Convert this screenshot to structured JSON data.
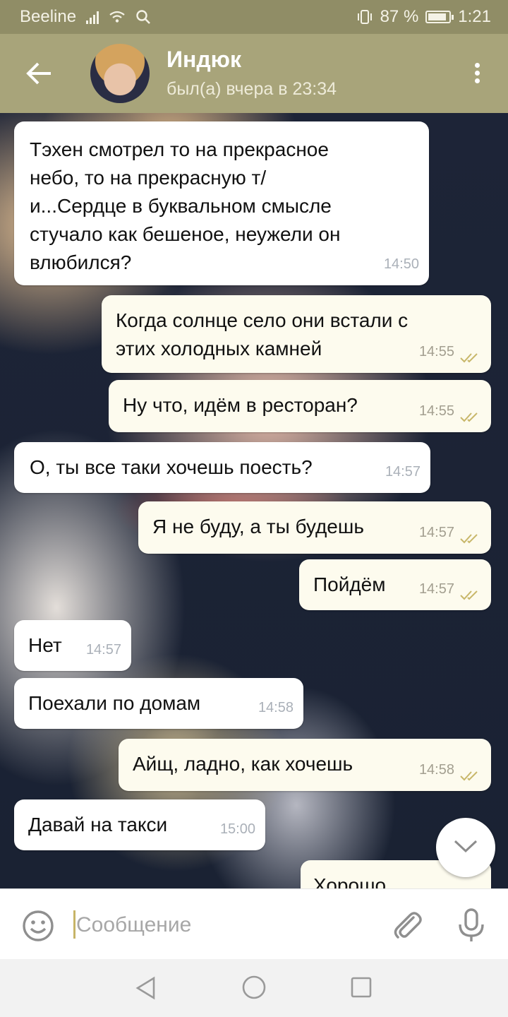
{
  "status_bar": {
    "carrier": "Beeline",
    "battery_percent": "87 %",
    "battery_level": 0.87,
    "time": "1:21"
  },
  "header": {
    "contact_name": "Индюк",
    "last_seen": "был(а) вчера в 23:34"
  },
  "messages": [
    {
      "direction": "in",
      "text": "Тэхен смотрел то на прекрасное небо, то на прекрасную т/и...Сердце в буквальном смысле стучало как бешеное, неужели он влюбился?",
      "lines": [
        "Тэхен смотрел то на прекрасное",
        "небо, то на прекрасную т/",
        "и...Сердце в буквальном смысле",
        "стучало как бешеное, неужели он",
        "влюбился?"
      ],
      "time": "14:50"
    },
    {
      "direction": "out",
      "text": "Когда солнце село они встали с этих холодных камней",
      "lines": [
        "Когда солнце село они встали с",
        "этих холодных камней"
      ],
      "time": "14:55",
      "read": true
    },
    {
      "direction": "out",
      "text": "Ну что, идём в ресторан?",
      "time": "14:55",
      "read": true
    },
    {
      "direction": "in",
      "text": "О, ты все таки хочешь поесть?",
      "time": "14:57"
    },
    {
      "direction": "out",
      "text": "Я не буду, а ты будешь",
      "time": "14:57",
      "read": true
    },
    {
      "direction": "out",
      "text": "Пойдём",
      "time": "14:57",
      "read": true
    },
    {
      "direction": "in",
      "text": "Нет",
      "time": "14:57"
    },
    {
      "direction": "in",
      "text": "Поехали по домам",
      "time": "14:58"
    },
    {
      "direction": "out",
      "text": "Айщ, ладно, как хочешь",
      "time": "14:58",
      "read": true
    },
    {
      "direction": "in",
      "text": "Давай на такси",
      "time": "15:00"
    },
    {
      "direction": "out",
      "text": "Хорошо",
      "time": "",
      "partial": true
    }
  ],
  "composer": {
    "placeholder": "Сообщение"
  },
  "icons": {
    "back": "arrow-left-icon",
    "menu": "more-vertical-icon",
    "emoji": "smiley-icon",
    "attach": "paperclip-icon",
    "mic": "microphone-icon",
    "scroll_down": "chevron-down-icon",
    "read_receipt": "double-check-icon"
  },
  "colors": {
    "status_bar": "#908d66",
    "header": "#a8a47a",
    "incoming_bubble": "#ffffff",
    "outgoing_bubble": "#fdfbee",
    "read_ticks": "#c8b76a",
    "cursor": "#c7b467"
  }
}
